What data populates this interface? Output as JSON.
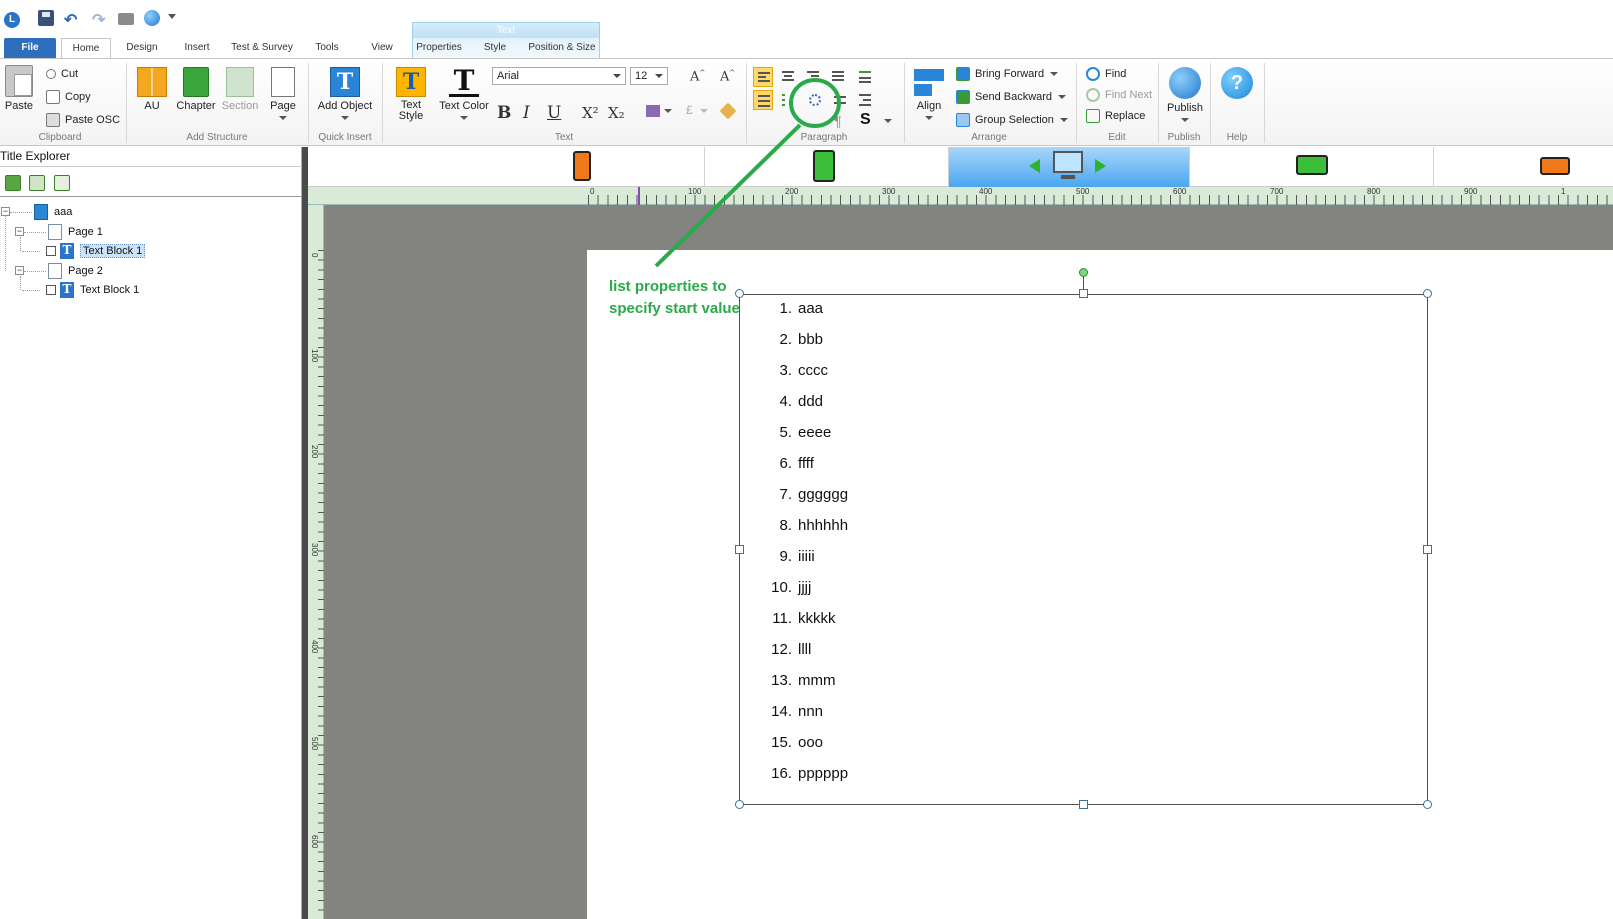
{
  "quick_access": {
    "icons": [
      "app-logo",
      "save",
      "undo",
      "redo",
      "print",
      "publish-globe",
      "customize-dropdown"
    ],
    "logo_letter": "L"
  },
  "contextual_tab": {
    "header": "Text"
  },
  "tabs": [
    {
      "label": "File",
      "selected": false
    },
    {
      "label": "Home",
      "selected": true
    },
    {
      "label": "Design",
      "selected": false
    },
    {
      "label": "Insert",
      "selected": false
    },
    {
      "label": "Test & Survey",
      "selected": false
    },
    {
      "label": "Tools",
      "selected": false
    },
    {
      "label": "View",
      "selected": false
    },
    {
      "label": "Properties",
      "selected": false
    },
    {
      "label": "Style",
      "selected": false
    },
    {
      "label": "Position & Size",
      "selected": false
    }
  ],
  "ribbon": {
    "clipboard": {
      "label": "Clipboard",
      "paste": "Paste",
      "cut": "Cut",
      "copy": "Copy",
      "paste_osc": "Paste OSC"
    },
    "add_structure": {
      "label": "Add Structure",
      "au": "AU",
      "chapter": "Chapter",
      "section": "Section",
      "page": "Page"
    },
    "quick_insert": {
      "label": "Quick Insert",
      "add_object": "Add Object"
    },
    "text": {
      "label": "Text",
      "text_style": "Text\nStyle",
      "text_color": "Text Color",
      "font": "Arial",
      "size": "12",
      "bold": "B",
      "italic": "I",
      "underline": "U",
      "superscript": "X²",
      "subscript": "X₂"
    },
    "paragraph": {
      "label": "Paragraph"
    },
    "arrange": {
      "label": "Arrange",
      "align": "Align",
      "bring_forward": "Bring Forward",
      "send_backward": "Send Backward",
      "group_selection": "Group Selection"
    },
    "edit": {
      "label": "Edit",
      "find": "Find",
      "find_next": "Find Next",
      "replace": "Replace"
    },
    "publish": {
      "label": "Publish",
      "publish": "Publish"
    },
    "help": {
      "label": "Help"
    }
  },
  "explorer": {
    "title": "Title Explorer",
    "tree": [
      {
        "label": "aaa",
        "type": "title"
      },
      {
        "label": "Page 1",
        "type": "page"
      },
      {
        "label": "Text Block 1",
        "type": "text-block",
        "selected": true
      },
      {
        "label": "Page 2",
        "type": "page"
      },
      {
        "label": "Text Block 1",
        "type": "text-block",
        "selected": false
      }
    ]
  },
  "devices": [
    "phone-portrait",
    "tablet-portrait",
    "desktop",
    "tablet-landscape",
    "phone-landscape"
  ],
  "ruler_top": [
    "0",
    "100",
    "200",
    "300",
    "400",
    "500",
    "600",
    "700",
    "800",
    "900",
    "1"
  ],
  "ruler_left": [
    "0",
    "100",
    "200",
    "300",
    "400",
    "500",
    "600"
  ],
  "annotation": {
    "text": "list properties to\nspecify start value",
    "color": "#2aaa4a"
  },
  "list_items": [
    {
      "num": "1.",
      "text": "aaa"
    },
    {
      "num": "2.",
      "text": "bbb"
    },
    {
      "num": "3.",
      "text": "cccc"
    },
    {
      "num": "4.",
      "text": "ddd"
    },
    {
      "num": "5.",
      "text": "eeee"
    },
    {
      "num": "6.",
      "text": "ffff"
    },
    {
      "num": "7.",
      "text": "gggggg"
    },
    {
      "num": "8.",
      "text": "hhhhhh"
    },
    {
      "num": "9.",
      "text": "iiiii"
    },
    {
      "num": "10.",
      "text": "jjjj"
    },
    {
      "num": "11.",
      "text": "kkkkk"
    },
    {
      "num": "12.",
      "text": "llll"
    },
    {
      "num": "13.",
      "text": "mmm"
    },
    {
      "num": "14.",
      "text": "nnn"
    },
    {
      "num": "15.",
      "text": "ooo"
    },
    {
      "num": "16.",
      "text": "pppppp"
    }
  ],
  "colors": {
    "accent": "#2d6ebd",
    "annotation_green": "#2aaa4a",
    "canvas": "#838480"
  }
}
